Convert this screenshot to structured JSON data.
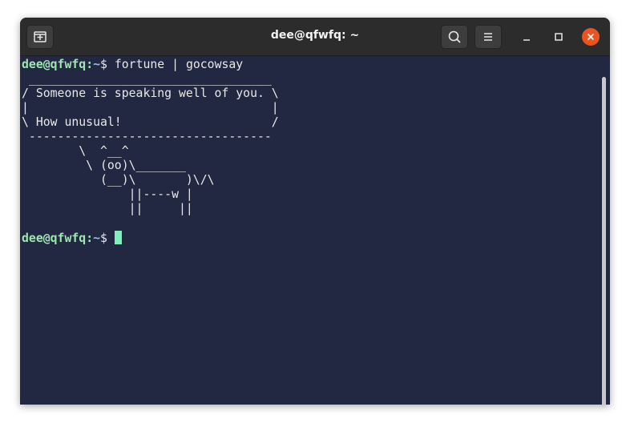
{
  "window": {
    "title": "dee@qfwfq: ~"
  },
  "titlebar": {
    "new_tab_icon": "new-tab-icon",
    "search_icon": "search-icon",
    "menu_icon": "hamburger-menu-icon",
    "minimize_icon": "minimize-icon",
    "maximize_icon": "maximize-icon",
    "close_icon": "close-icon"
  },
  "terminal": {
    "prompt_user": "dee@qfwfq",
    "prompt_sep": ":",
    "prompt_path": "~",
    "prompt_symbol": "$ ",
    "command": "fortune | gocowsay",
    "output": " __________________________________\n/ Someone is speaking well of you. \\\n|                                  |\n\\ How unusual!                     /\n ----------------------------------\n        \\  ^__^\n         \\ (oo)\\_______\n           (__)\\       )\\/\\\n               ||----w |\n               ||     ||\n"
  },
  "colors": {
    "background": "#232842",
    "prompt_user": "#9ee6b0",
    "prompt_path": "#9ab8e8",
    "cursor": "#7ff0b8",
    "close_button": "#e95420"
  }
}
